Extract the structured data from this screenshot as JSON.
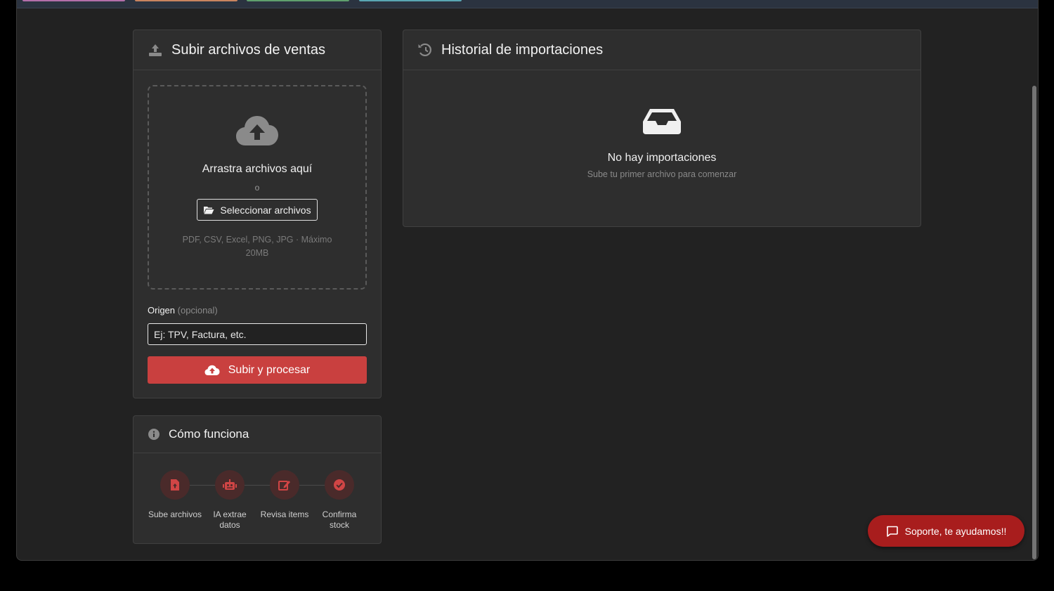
{
  "colors": {
    "accent": "#c9403f",
    "support": "#a81d1d",
    "icon_gray": "#8a8a8a"
  },
  "upload": {
    "title": "Subir archivos de ventas",
    "icon": "upload-icon",
    "dropzone": {
      "title": "Arrastra archivos aquí",
      "or": "o",
      "select_label": "Seleccionar archivos",
      "hint": "PDF, CSV, Excel, PNG, JPG · Máximo 20MB"
    },
    "origin_label": "Origen",
    "origin_optional": "(opcional)",
    "origin_placeholder": "Ej: TPV, Factura, etc.",
    "submit_label": "Subir y procesar"
  },
  "how": {
    "title": "Cómo funciona",
    "steps": [
      {
        "label": "Sube archivos",
        "icon": "file-upload-icon"
      },
      {
        "label": "IA extrae datos",
        "icon": "robot-icon"
      },
      {
        "label": "Revisa items",
        "icon": "edit-icon"
      },
      {
        "label": "Confirma stock",
        "icon": "check-circle-icon"
      }
    ]
  },
  "history": {
    "title": "Historial de importaciones",
    "icon": "history-icon",
    "empty_title": "No hay importaciones",
    "empty_sub": "Sube tu primer archivo para comenzar"
  },
  "support": {
    "label": "Soporte, te ayudamos!!"
  }
}
